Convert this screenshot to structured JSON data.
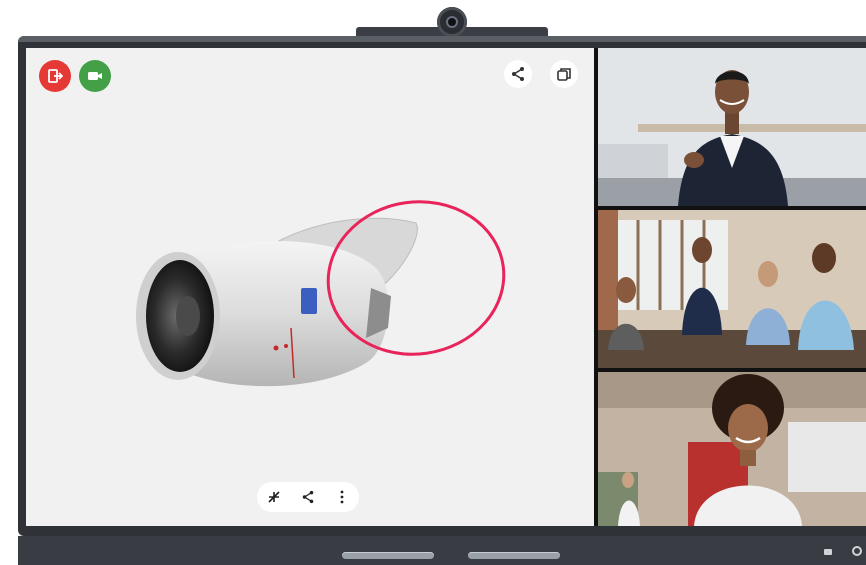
{
  "device": {
    "frame_color": "#2f3338",
    "base_color": "#393d43"
  },
  "whiteboard": {
    "background": "#f1f1f1",
    "top_left_buttons": [
      {
        "icon": "leave-icon",
        "color": "#e53935"
      },
      {
        "icon": "video-camera-icon",
        "color": "#43a047"
      }
    ],
    "top_right_buttons": [
      {
        "icon": "share-icon"
      },
      {
        "icon": "window-switch-icon"
      }
    ],
    "bottom_toolbar": [
      {
        "icon": "collapse-icon"
      },
      {
        "icon": "share-icon"
      },
      {
        "icon": "more-vertical-icon"
      }
    ],
    "annotation_color": "#e8245a"
  },
  "participants": [
    {
      "tile": "single-presenter",
      "icon": "person-in-suit"
    },
    {
      "tile": "conference-room-group",
      "icon": "group-of-four"
    },
    {
      "tile": "single-participant",
      "icon": "person-smiling"
    }
  ]
}
